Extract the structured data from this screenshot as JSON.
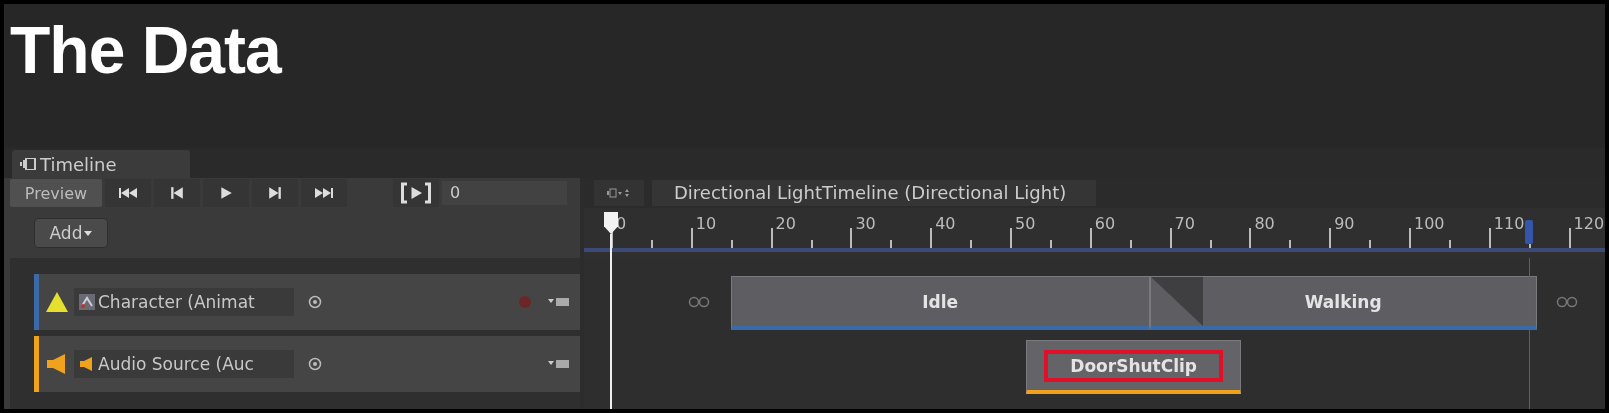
{
  "title": "The Data",
  "window": {
    "tab": "Timeline"
  },
  "toolbar": {
    "preview": "Preview",
    "frame": "0"
  },
  "add_button": "Add",
  "breadcrumb": "Directional LightTimeline (Directional Light)",
  "ruler": {
    "labels": [
      "0",
      "10",
      "20",
      "30",
      "40",
      "50",
      "60",
      "70",
      "80",
      "90",
      "100",
      "110",
      "120"
    ]
  },
  "tracks": [
    {
      "kind": "animation",
      "name": "Character (Animat",
      "color": "#3a6aa8",
      "clips": [
        {
          "label": "Idle",
          "selected": false
        },
        {
          "label": "Walking",
          "selected": false
        }
      ]
    },
    {
      "kind": "audio",
      "name": "Audio Source (Auc",
      "color": "#f0a21c",
      "clips": [
        {
          "label": "DoorShutClip",
          "selected": true
        }
      ]
    }
  ]
}
